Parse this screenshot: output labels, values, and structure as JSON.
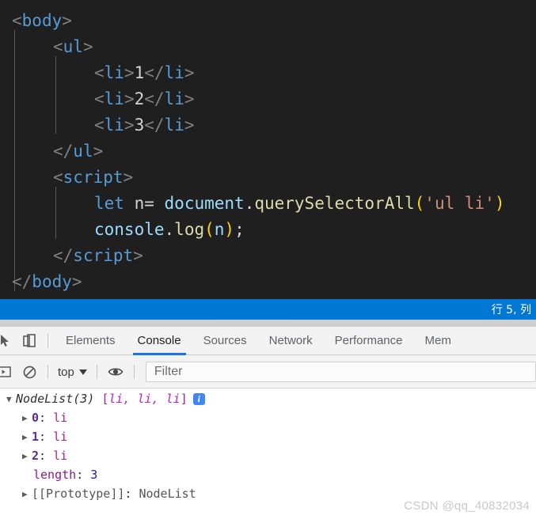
{
  "editor": {
    "lines": [
      {
        "indent": 0,
        "tokens": [
          {
            "t": "tb",
            "v": "<"
          },
          {
            "t": "tn",
            "v": "body"
          },
          {
            "t": "tb",
            "v": ">"
          }
        ]
      },
      {
        "indent": 1,
        "tokens": [
          {
            "t": "tb",
            "v": "<"
          },
          {
            "t": "tn",
            "v": "ul"
          },
          {
            "t": "tb",
            "v": ">"
          }
        ]
      },
      {
        "indent": 2,
        "tokens": [
          {
            "t": "tb",
            "v": "<"
          },
          {
            "t": "tn",
            "v": "li"
          },
          {
            "t": "tb",
            "v": ">"
          },
          {
            "t": "txt",
            "v": "1"
          },
          {
            "t": "tb",
            "v": "</"
          },
          {
            "t": "tn",
            "v": "li"
          },
          {
            "t": "tb",
            "v": ">"
          }
        ]
      },
      {
        "indent": 2,
        "tokens": [
          {
            "t": "tb",
            "v": "<"
          },
          {
            "t": "tn",
            "v": "li"
          },
          {
            "t": "tb",
            "v": ">"
          },
          {
            "t": "txt",
            "v": "2"
          },
          {
            "t": "tb",
            "v": "</"
          },
          {
            "t": "tn",
            "v": "li"
          },
          {
            "t": "tb",
            "v": ">"
          }
        ]
      },
      {
        "indent": 2,
        "tokens": [
          {
            "t": "tb",
            "v": "<"
          },
          {
            "t": "tn",
            "v": "li"
          },
          {
            "t": "tb",
            "v": ">"
          },
          {
            "t": "txt",
            "v": "3"
          },
          {
            "t": "tb",
            "v": "</"
          },
          {
            "t": "tn",
            "v": "li"
          },
          {
            "t": "tb",
            "v": ">"
          }
        ]
      },
      {
        "indent": 1,
        "tokens": [
          {
            "t": "tb",
            "v": "</"
          },
          {
            "t": "tn",
            "v": "ul"
          },
          {
            "t": "tb",
            "v": ">"
          }
        ]
      },
      {
        "indent": 1,
        "tokens": [
          {
            "t": "tb",
            "v": "<"
          },
          {
            "t": "tn",
            "v": "script"
          },
          {
            "t": "tb",
            "v": ">"
          }
        ]
      },
      {
        "indent": 2,
        "tokens": [
          {
            "t": "kw",
            "v": "let"
          },
          {
            "t": "op",
            "v": " n"
          },
          {
            "t": "op",
            "v": "= "
          },
          {
            "t": "var",
            "v": "document"
          },
          {
            "t": "op",
            "v": "."
          },
          {
            "t": "fn",
            "v": "querySelectorAll"
          },
          {
            "t": "pn1",
            "v": "("
          },
          {
            "t": "str",
            "v": "'ul li'"
          },
          {
            "t": "pn1",
            "v": ")"
          }
        ]
      },
      {
        "indent": 2,
        "tokens": [
          {
            "t": "var",
            "v": "console"
          },
          {
            "t": "op",
            "v": "."
          },
          {
            "t": "fn",
            "v": "log"
          },
          {
            "t": "pn1",
            "v": "("
          },
          {
            "t": "var",
            "v": "n"
          },
          {
            "t": "pn1",
            "v": ")"
          },
          {
            "t": "op",
            "v": ";"
          }
        ]
      },
      {
        "indent": 1,
        "tokens": [
          {
            "t": "tb",
            "v": "</"
          },
          {
            "t": "tn",
            "v": "script"
          },
          {
            "t": "tb",
            "v": ">"
          }
        ]
      },
      {
        "indent": 0,
        "tokens": [
          {
            "t": "tb",
            "v": "</"
          },
          {
            "t": "tn",
            "v": "body"
          },
          {
            "t": "tb",
            "v": ">"
          }
        ]
      }
    ]
  },
  "statusbar": {
    "position_text": "行 5, 列"
  },
  "devtools": {
    "tabs": [
      {
        "label": "Elements",
        "active": false
      },
      {
        "label": "Console",
        "active": true
      },
      {
        "label": "Sources",
        "active": false
      },
      {
        "label": "Network",
        "active": false
      },
      {
        "label": "Performance",
        "active": false
      },
      {
        "label": "Mem",
        "active": false
      }
    ],
    "console_toolbar": {
      "context_label": "top",
      "filter_placeholder": "Filter"
    },
    "console_output": {
      "header": {
        "arrow": "▼",
        "type_name": "NodeList(3)",
        "preview_open": "[",
        "preview_items": "li, li, li",
        "preview_close": "]",
        "info_badge": "i"
      },
      "rows": [
        {
          "arrow": "▶",
          "index": "0",
          "colon": ": ",
          "value": "li"
        },
        {
          "arrow": "▶",
          "index": "1",
          "colon": ": ",
          "value": "li"
        },
        {
          "arrow": "▶",
          "index": "2",
          "colon": ": ",
          "value": "li"
        }
      ],
      "length_row": {
        "key": "length",
        "colon": ": ",
        "value": "3"
      },
      "proto_row": {
        "arrow": "▶",
        "key": "[[Prototype]]",
        "colon": ": ",
        "value": "NodeList"
      }
    }
  },
  "watermark": {
    "text": "CSDN @qq_40832034"
  },
  "colors": {
    "editor_bg": "#1f1f1f",
    "status_blue": "#0078d4",
    "tab_accent": "#1a73e8",
    "devtools_bg": "#f3f3f3",
    "console_bg": "#ffffff",
    "info_badge": "#4285f4"
  }
}
